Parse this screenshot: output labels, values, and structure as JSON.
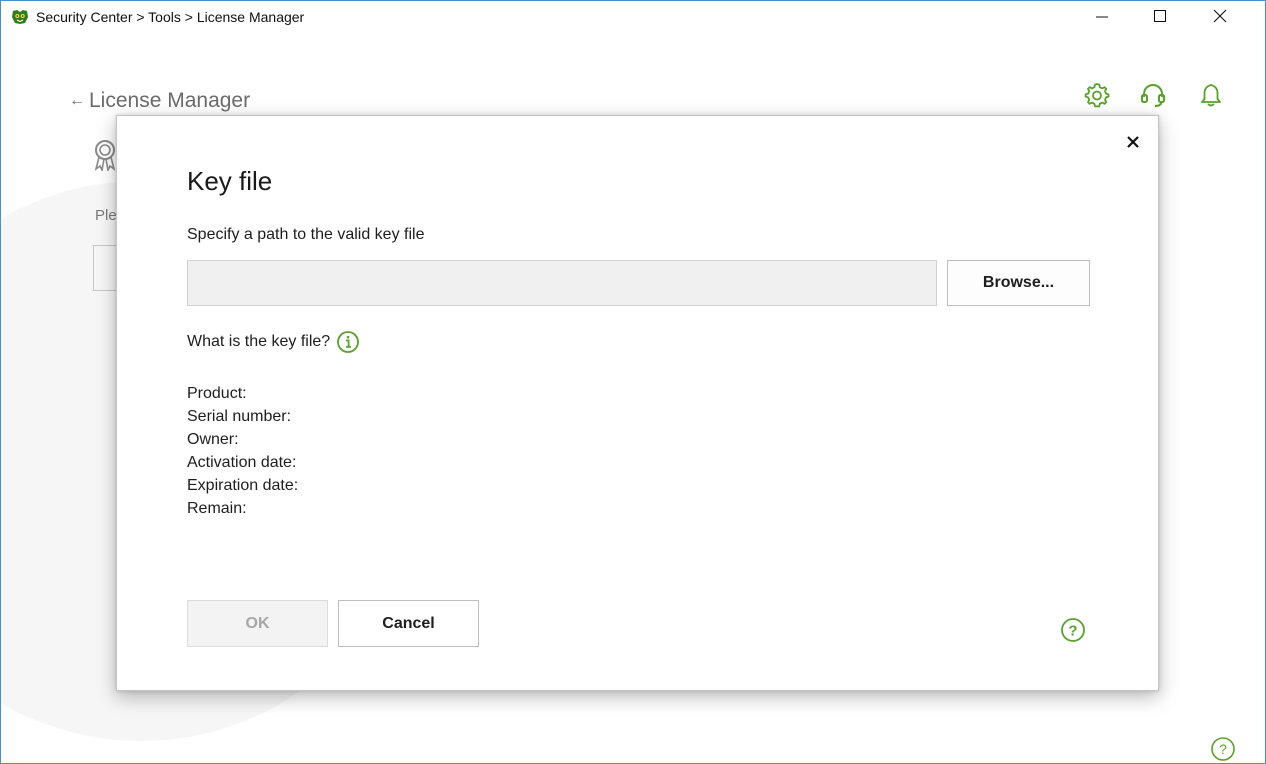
{
  "window": {
    "title": "Security Center > Tools > License Manager",
    "minimize_glyph": "—",
    "maximize_glyph": "☐",
    "close_glyph": "✕"
  },
  "page": {
    "back_arrow": "←",
    "header": "License Manager",
    "partial_text": "Ple",
    "icons": [
      "settings-icon",
      "support-headset-icon",
      "notifications-bell-icon",
      "award-icon",
      "help-icon"
    ]
  },
  "dialog": {
    "title": "Key file",
    "path_label": "Specify a path to the valid key file",
    "path_value": "",
    "path_placeholder": "",
    "browse_label": "Browse...",
    "what_is_label": "What is the key file?",
    "fields": [
      "Product:",
      "Serial number:",
      "Owner:",
      "Activation date:",
      "Expiration date:",
      "Remain:"
    ],
    "ok_label": "OK",
    "cancel_label": "Cancel",
    "close_glyph": "✕"
  },
  "colors": {
    "accent_green": "#5aa02c",
    "window_border": "#4a90c8",
    "disabled_text": "#a6a6a6"
  }
}
